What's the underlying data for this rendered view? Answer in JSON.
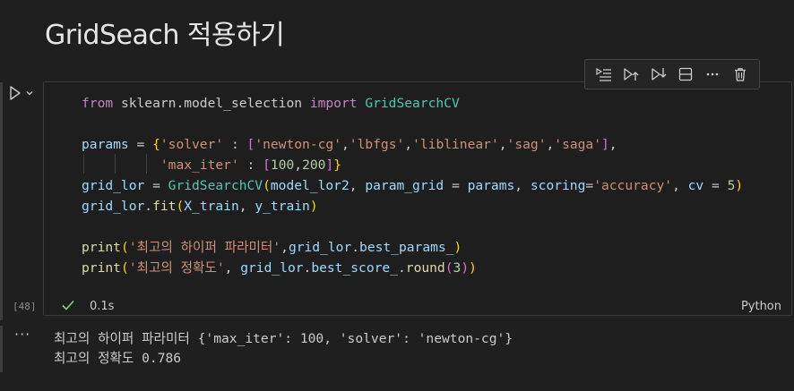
{
  "heading": "GridSeach 적용하기",
  "cell": {
    "execution_count": "[48]",
    "status_time": "0.1s",
    "language": "Python",
    "code": {
      "l1": {
        "kw1": "from",
        "mod": " sklearn.model_selection ",
        "kw2": "import",
        "cls": " GridSearchCV"
      },
      "l3": {
        "var": "params",
        "eq": " = ",
        "b1": "{",
        "k1": "'solver'",
        "c1": " : ",
        "b2": "[",
        "s1": "'newton-cg'",
        "s2": "'lbfgs'",
        "s3": "'liblinear'",
        "s4": "'sag'",
        "s5": "'saga'",
        "b2c": "]",
        "comma": ","
      },
      "l4": {
        "k2": "'max_iter'",
        "c2": " : ",
        "b3": "[",
        "n1": "100",
        "sep": ",",
        "n2": "200",
        "b3c": "]",
        "b1c": "}"
      },
      "l5": {
        "var": "grid_lor",
        "eq": " = ",
        "cls": "GridSearchCV",
        "p": "(",
        "a1": "model_lor2",
        "c1": ", ",
        "a2": "param_grid",
        "eq2": " = ",
        "a3": "params",
        "c2": ", ",
        "a4": "scoring",
        "eq3": "=",
        "s": "'accuracy'",
        "c3": ", ",
        "a5": "cv",
        "eq4": " = ",
        "n": "5",
        "pc": ")"
      },
      "l6": {
        "var": "grid_lor",
        "dot": ".",
        "fn": "fit",
        "p": "(",
        "a1": "X_train",
        "c": ", ",
        "a2": "y_train",
        "pc": ")"
      },
      "l8": {
        "fn": "print",
        "p": "(",
        "s": "'최고의 하이퍼 파라미터'",
        "c": ",",
        "var": "grid_lor",
        "dot": ".",
        "attr": "best_params_",
        "pc": ")"
      },
      "l9": {
        "fn": "print",
        "p": "(",
        "s": "'최고의 정확도'",
        "c": ", ",
        "var": "grid_lor",
        "dot": ".",
        "attr": "best_score_",
        "dot2": ".",
        "fn2": "round",
        "p2": "(",
        "n": "3",
        "pc2": ")",
        "pc": ")"
      }
    }
  },
  "output": {
    "line1": "최고의 하이퍼 파라미터 {'max_iter': 100, 'solver': 'newton-cg'}",
    "line2": "최고의 정확도 0.786"
  },
  "toolbar": {
    "buttons": [
      "run-by-line-icon",
      "execute-above-icon",
      "execute-below-icon",
      "split-cell-icon",
      "more-actions-icon",
      "delete-icon"
    ]
  },
  "colors": {
    "background": "#1f1f1f",
    "keyword": "#c586c0",
    "string": "#ce9178",
    "class": "#4ec9b0",
    "variable": "#9cdcfe",
    "function": "#dcdcaa",
    "number": "#b5cea8",
    "success": "#89d185"
  }
}
